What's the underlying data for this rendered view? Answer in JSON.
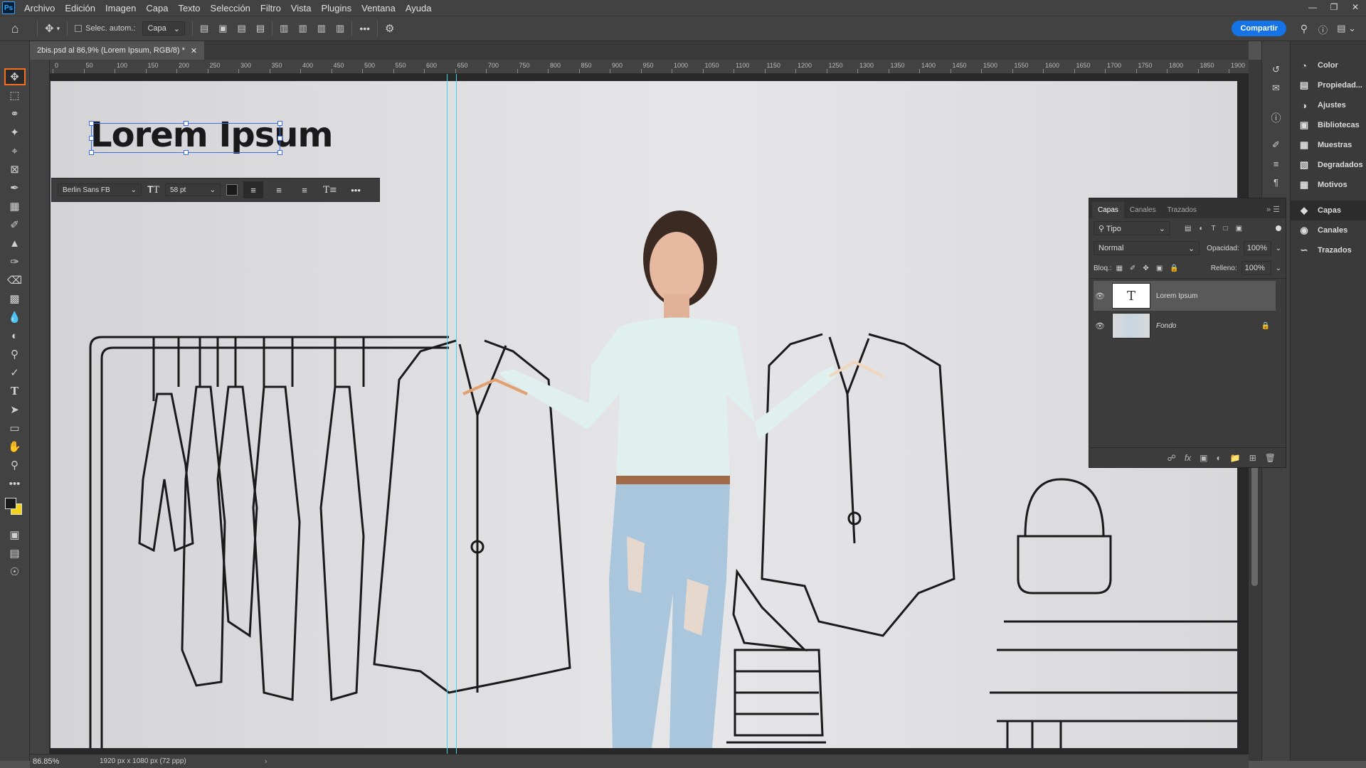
{
  "menu": [
    "Archivo",
    "Edición",
    "Imagen",
    "Capa",
    "Texto",
    "Selección",
    "Filtro",
    "Vista",
    "Plugins",
    "Ventana",
    "Ayuda"
  ],
  "app_logo": "Ps",
  "options": {
    "auto_select_label": "Selec. autom.:",
    "auto_select_target": "Capa",
    "share_label": "Compartir"
  },
  "document_tab": "2bis.psd al 86,9% (Lorem Ipsum, RGB/8) *",
  "ruler_ticks": [
    "0",
    "50",
    "100",
    "150",
    "200",
    "250",
    "300",
    "350",
    "400",
    "450",
    "500",
    "550",
    "600",
    "650",
    "700",
    "750",
    "800",
    "850",
    "900",
    "950",
    "1000",
    "1050",
    "1100",
    "1150",
    "1200",
    "1250",
    "1300",
    "1350",
    "1400",
    "1450",
    "1500",
    "1550",
    "1600",
    "1650",
    "1700",
    "1750",
    "1800",
    "1850",
    "1900"
  ],
  "canvas_text": "Lorem Ipsum",
  "text_context_bar": {
    "font_family": "Berlin Sans FB",
    "font_size": "58 pt"
  },
  "panel_strip": [
    {
      "label": "Color",
      "icon": "color-wheel-icon"
    },
    {
      "label": "Propiedad...",
      "icon": "properties-icon"
    },
    {
      "label": "Ajustes",
      "icon": "adjustments-icon"
    },
    {
      "label": "Bibliotecas",
      "icon": "libraries-icon"
    },
    {
      "label": "Muestras",
      "icon": "swatches-icon"
    },
    {
      "label": "Degradados",
      "icon": "gradients-icon"
    },
    {
      "label": "Motivos",
      "icon": "patterns-icon"
    },
    {
      "label": "Capas",
      "icon": "layers-icon"
    },
    {
      "label": "Canales",
      "icon": "channels-icon"
    },
    {
      "label": "Trazados",
      "icon": "paths-icon"
    }
  ],
  "layers_panel": {
    "tabs": [
      "Capas",
      "Canales",
      "Trazados"
    ],
    "filter": "Tipo",
    "blend_mode": "Normal",
    "opacity_label": "Opacidad:",
    "opacity_value": "100%",
    "lock_label": "Bloq.:",
    "fill_label": "Relleno:",
    "fill_value": "100%",
    "layers": [
      {
        "name": "Lorem Ipsum",
        "type": "text",
        "selected": true
      },
      {
        "name": "Fondo",
        "type": "image",
        "locked": true
      }
    ]
  },
  "status": {
    "zoom": "86.85%",
    "doc_info": "1920 px x 1080 px (72 ppp)"
  }
}
